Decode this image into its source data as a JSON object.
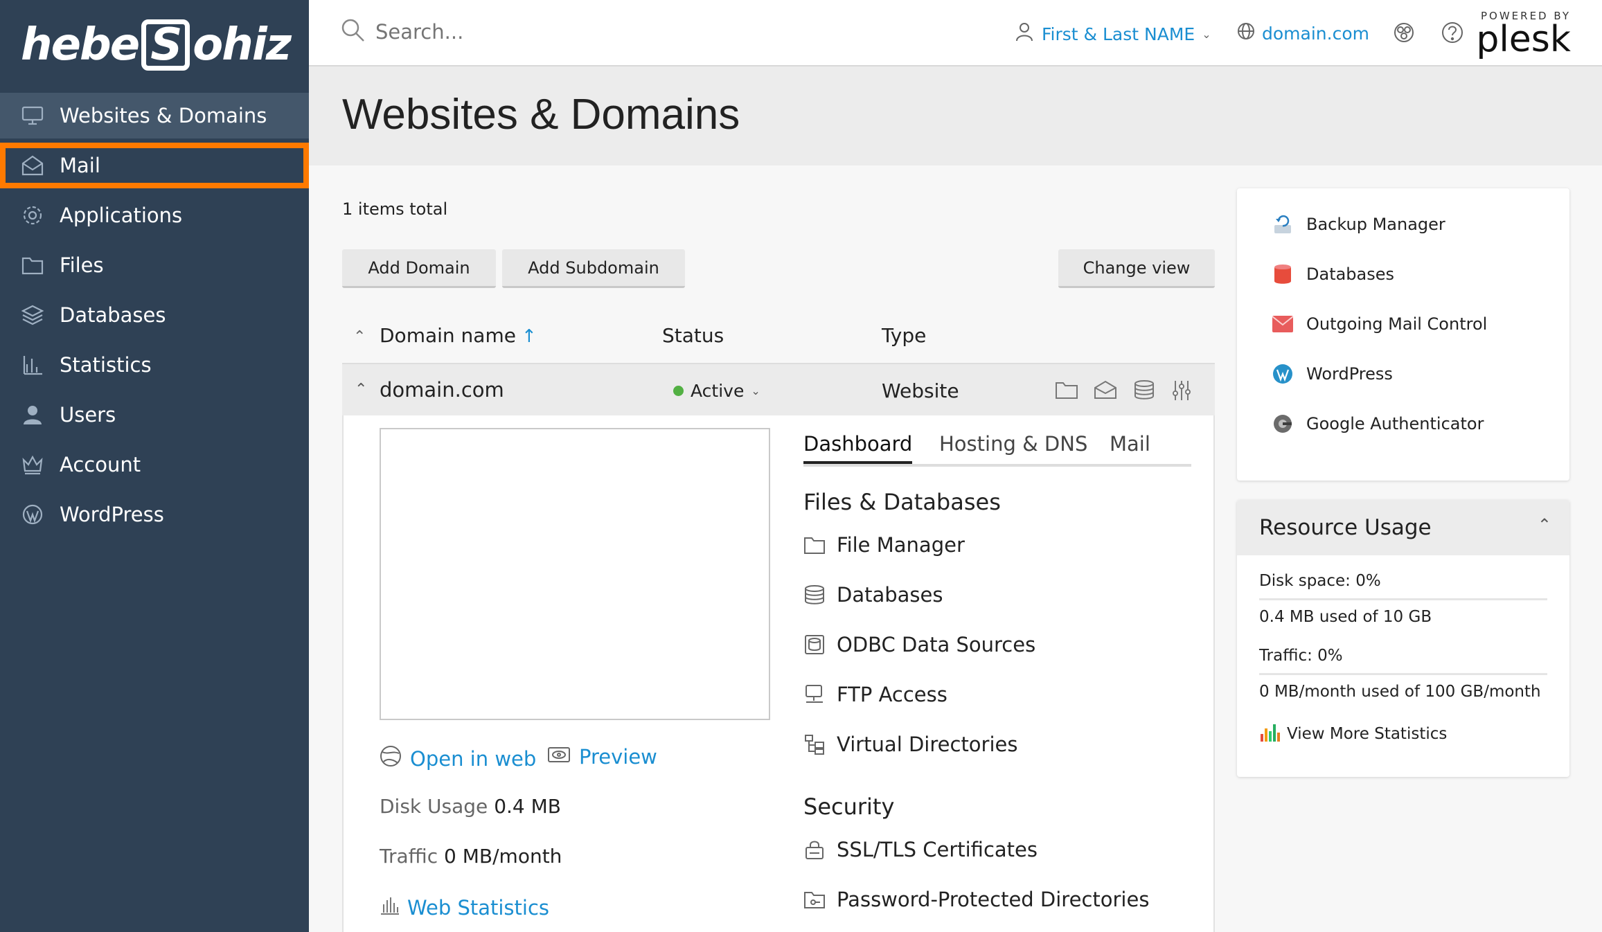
{
  "brand": {
    "logo_text_left": "hebe",
    "logo_text_mark": "S",
    "logo_text_right": "ohiz"
  },
  "sidebar": {
    "items": [
      {
        "label": "Websites & Domains",
        "icon": "monitor-icon"
      },
      {
        "label": "Mail",
        "icon": "mail-icon"
      },
      {
        "label": "Applications",
        "icon": "gear-icon"
      },
      {
        "label": "Files",
        "icon": "folder-icon"
      },
      {
        "label": "Databases",
        "icon": "layers-icon"
      },
      {
        "label": "Statistics",
        "icon": "bar-chart-icon"
      },
      {
        "label": "Users",
        "icon": "user-icon"
      },
      {
        "label": "Account",
        "icon": "crown-icon"
      },
      {
        "label": "WordPress",
        "icon": "wordpress-icon"
      }
    ],
    "active": "Websites & Domains",
    "highlighted": "Mail",
    "highlight_color": "#ff7a00"
  },
  "topbar": {
    "search_placeholder": "Search...",
    "user_name": "First & Last NAME",
    "domain": "domain.com",
    "powered_by": "POWERED BY",
    "plesk": "plesk"
  },
  "page": {
    "title": "Websites & Domains"
  },
  "list": {
    "items_total": "1 items total",
    "buttons": {
      "add_domain": "Add Domain",
      "add_subdomain": "Add Subdomain",
      "change_view": "Change view"
    },
    "columns": {
      "domain": "Domain name",
      "sort_arrow": "↑",
      "status": "Status",
      "type": "Type"
    },
    "row": {
      "domain": "domain.com",
      "status": "Active",
      "type": "Website"
    }
  },
  "domain_panel": {
    "open_in_web": "Open in web",
    "preview": "Preview",
    "disk_usage_label": "Disk Usage",
    "disk_usage_value": "0.4 MB",
    "traffic_label": "Traffic",
    "traffic_value": "0 MB/month",
    "web_statistics": "Web Statistics",
    "tabs": [
      "Dashboard",
      "Hosting & DNS",
      "Mail"
    ],
    "active_tab": "Dashboard",
    "sections": {
      "files_title": "Files & Databases",
      "files_items": [
        "File Manager",
        "Databases",
        "ODBC Data Sources",
        "FTP Access",
        "Virtual Directories"
      ],
      "security_title": "Security",
      "security_items": [
        "SSL/TLS Certificates",
        "Password-Protected Directories"
      ]
    }
  },
  "tools": [
    "Backup Manager",
    "Databases",
    "Outgoing Mail Control",
    "WordPress",
    "Google Authenticator"
  ],
  "resource_usage": {
    "title": "Resource Usage",
    "disk": "Disk space: 0%",
    "disk_detail": "0.4 MB used of 10 GB",
    "traffic": "Traffic: 0%",
    "traffic_detail": "0 MB/month used of 100 GB/month",
    "more": "View More Statistics"
  },
  "colors": {
    "sidebar_bg": "#2f4155",
    "link": "#1a8ed1",
    "active_status": "#52b043"
  }
}
